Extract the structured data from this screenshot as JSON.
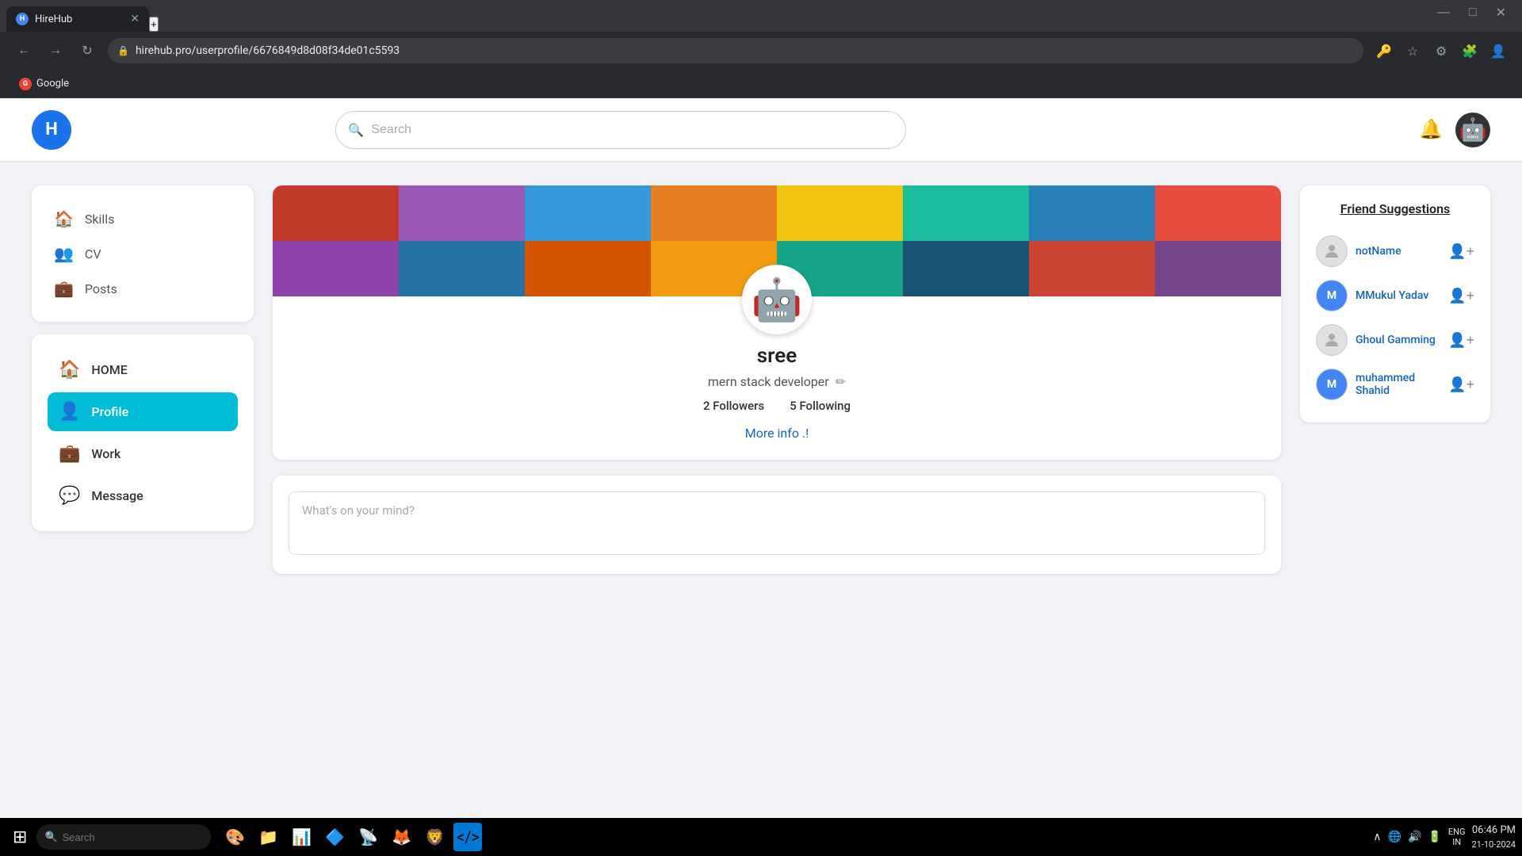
{
  "browser": {
    "tab_label": "HireHub",
    "tab_favicon": "H",
    "url": "hirehub.pro/userprofile/6676849d8d08f34de01c5593",
    "window_minimize": "—",
    "window_maximize": "□",
    "window_close": "✕"
  },
  "bookmarks": {
    "google_label": "Google"
  },
  "header": {
    "logo_letter": "H",
    "search_placeholder": "Search",
    "notification_icon": "🔔"
  },
  "sidebar_top": {
    "items": [
      {
        "label": "Skills",
        "icon": "🏠"
      },
      {
        "label": "CV",
        "icon": "👥"
      },
      {
        "label": "Posts",
        "icon": "💼"
      }
    ]
  },
  "sidebar_nav": {
    "items": [
      {
        "label": "HOME",
        "icon": "🏠",
        "active": false
      },
      {
        "label": "Profile",
        "icon": "👤",
        "active": true
      },
      {
        "label": "Work",
        "icon": "💼",
        "active": false
      },
      {
        "label": "Message",
        "icon": "💬",
        "active": false
      }
    ]
  },
  "profile": {
    "name": "sree",
    "bio": "mern stack developer",
    "followers_count": "2",
    "followers_label": "Followers",
    "following_count": "5",
    "following_label": "Following",
    "more_info_label": "More info .!",
    "avatar_emoji": "🤖"
  },
  "post_box": {
    "placeholder": "What's on your mind?"
  },
  "friend_suggestions": {
    "title": "Friend Suggestions",
    "friends": [
      {
        "name": "notName",
        "has_pic": false,
        "initial": ""
      },
      {
        "name": "MMukul Yadav",
        "has_pic": true,
        "initial": "M"
      },
      {
        "name": "Ghoul Gamming",
        "has_pic": false,
        "initial": ""
      },
      {
        "name": "muhammed Shahid",
        "has_pic": true,
        "initial": "M"
      }
    ]
  },
  "taskbar": {
    "search_placeholder": "Search",
    "apps": [
      "🎨",
      "📁",
      "📊",
      "🔷",
      "📡",
      "🦊",
      "🛡️"
    ],
    "language": "ENG\nIN",
    "time": "06:46 PM",
    "date": "21-10-2024"
  },
  "cover_colors": [
    "#c0392b",
    "#9b59b6",
    "#3498db",
    "#e67e22",
    "#f1c40f",
    "#1abc9c",
    "#2980b9",
    "#e74c3c",
    "#8e44ad",
    "#2471a3",
    "#d35400",
    "#f39c12",
    "#17a589",
    "#1a5276",
    "#cb4335",
    "#76448a"
  ]
}
